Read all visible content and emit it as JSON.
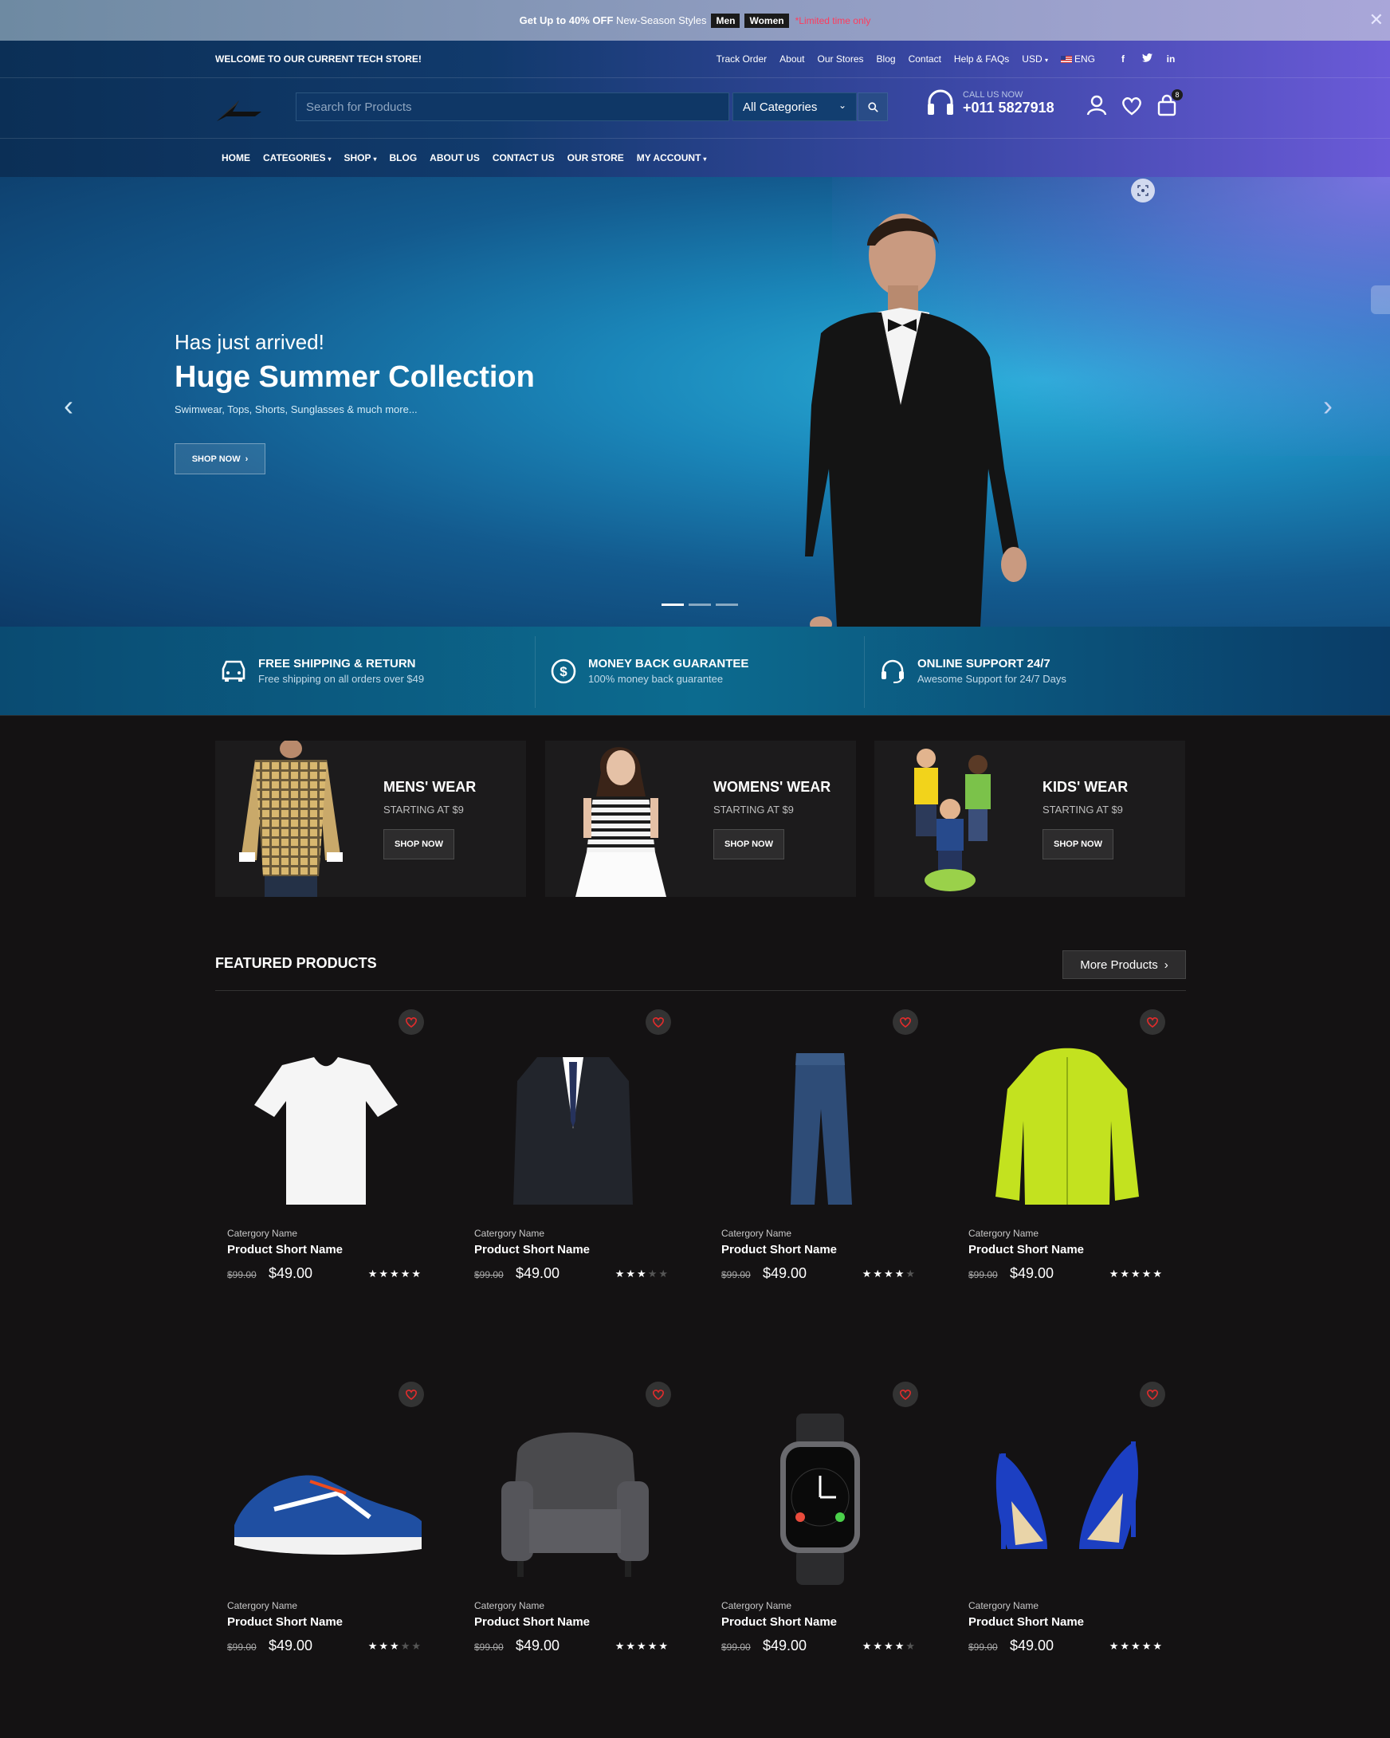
{
  "announce": {
    "prefix": "Get Up to",
    "highlight": "40% OFF",
    "suffix": "New-Season Styles",
    "tag_men": "Men",
    "tag_women": "Women",
    "limited": "*Limited time only",
    "close": "✕"
  },
  "topbar": {
    "welcome": "WELCOME TO OUR CURRENT TECH STORE!",
    "links": [
      "Track Order",
      "About",
      "Our Stores",
      "Blog",
      "Contact",
      "Help & FAQs"
    ],
    "currency": "USD",
    "language": "ENG",
    "social": [
      "f",
      "t",
      "in"
    ]
  },
  "search": {
    "placeholder": "Search for Products",
    "category": "All Categories"
  },
  "call": {
    "label": "CALL US NOW",
    "number": "+011 5827918"
  },
  "cart_count": "8",
  "nav": [
    "HOME",
    "CATEGORIES",
    "SHOP",
    "BLOG",
    "ABOUT US",
    "CONTACT US",
    "OUR STORE",
    "MY ACCOUNT"
  ],
  "hero": {
    "subtitle": "Has just arrived!",
    "title": "Huge Summer Collection",
    "description": "Swimwear, Tops, Shorts, Sunglasses & much more...",
    "button": "SHOP NOW"
  },
  "features": [
    {
      "title": "FREE SHIPPING & RETURN",
      "desc": "Free shipping on all orders over $49",
      "icon": "delivery-truck-icon"
    },
    {
      "title": "MONEY BACK GUARANTEE",
      "desc": "100% money back guarantee",
      "icon": "dollar-circle-icon"
    },
    {
      "title": "ONLINE SUPPORT 24/7",
      "desc": "Awesome Support for 24/7 Days",
      "icon": "headset-icon"
    }
  ],
  "categories": [
    {
      "name": "MENS' WEAR",
      "starting": "STARTING AT $9",
      "button": "SHOP NOW"
    },
    {
      "name": "WOMENS' WEAR",
      "starting": "STARTING AT $9",
      "button": "SHOP NOW"
    },
    {
      "name": "KIDS' WEAR",
      "starting": "STARTING AT $9",
      "button": "SHOP NOW"
    }
  ],
  "featured": {
    "heading": "FEATURED PRODUCTS",
    "more": "More Products",
    "products": [
      {
        "category": "Catergory Name",
        "name": "Product Short Name",
        "old_price": "$99.00",
        "price": "$49.00",
        "rating": 5,
        "image": "white-tshirt"
      },
      {
        "category": "Catergory Name",
        "name": "Product Short Name",
        "old_price": "$99.00",
        "price": "$49.00",
        "rating": 3,
        "image": "suit-jacket"
      },
      {
        "category": "Catergory Name",
        "name": "Product Short Name",
        "old_price": "$99.00",
        "price": "$49.00",
        "rating": 4,
        "image": "jeans"
      },
      {
        "category": "Catergory Name",
        "name": "Product Short Name",
        "old_price": "$99.00",
        "price": "$49.00",
        "rating": 5,
        "image": "lime-jacket"
      },
      {
        "category": "Catergory Name",
        "name": "Product Short Name",
        "old_price": "$99.00",
        "price": "$49.00",
        "rating": 3,
        "image": "running-shoe"
      },
      {
        "category": "Catergory Name",
        "name": "Product Short Name",
        "old_price": "$99.00",
        "price": "$49.00",
        "rating": 5,
        "image": "armchair"
      },
      {
        "category": "Catergory Name",
        "name": "Product Short Name",
        "old_price": "$99.00",
        "price": "$49.00",
        "rating": 4,
        "image": "smart-watch"
      },
      {
        "category": "Catergory Name",
        "name": "Product Short Name",
        "old_price": "$99.00",
        "price": "$49.00",
        "rating": 5,
        "image": "blue-heels"
      }
    ]
  }
}
